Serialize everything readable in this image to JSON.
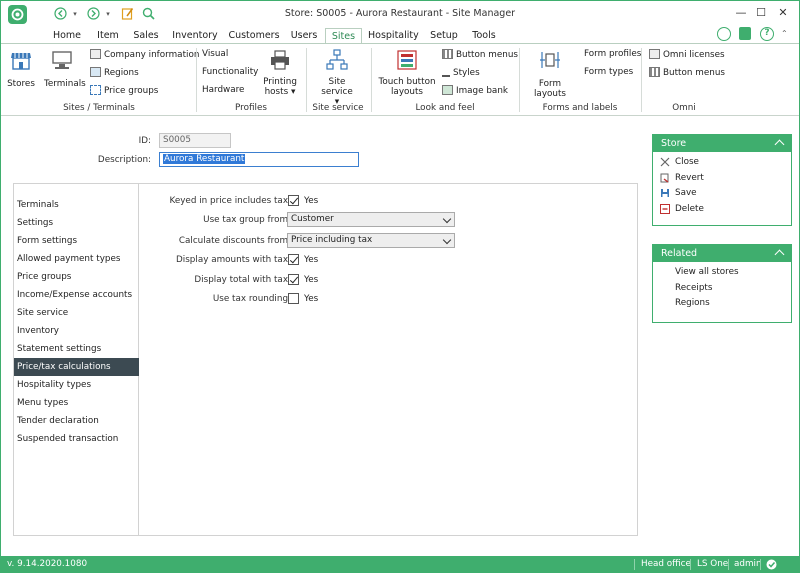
{
  "window": {
    "title": "Store: S0005 - Aurora Restaurant - Site Manager"
  },
  "tabs": [
    "Home",
    "Item",
    "Sales",
    "Inventory",
    "Customers",
    "Users",
    "Sites",
    "Hospitality",
    "Setup",
    "Tools"
  ],
  "active_tab": "Sites",
  "ribbon": {
    "sites_terminals": {
      "label": "Sites / Terminals",
      "stores": "Stores",
      "terminals": "Terminals",
      "company_information": "Company information",
      "regions": "Regions",
      "price_groups": "Price groups"
    },
    "profiles": {
      "label": "Profiles",
      "visual": "Visual",
      "functionality": "Functionality",
      "hardware": "Hardware",
      "printing_hosts_1": "Printing",
      "printing_hosts_2": "hosts"
    },
    "site_service": {
      "label": "Site service",
      "button": "Site service"
    },
    "look_and_feel": {
      "label": "Look and feel",
      "touch_button_layouts_1": "Touch button",
      "touch_button_layouts_2": "layouts",
      "button_menus": "Button menus",
      "styles": "Styles",
      "image_bank": "Image bank"
    },
    "forms_and_labels": {
      "label": "Forms and labels",
      "form_layouts": "Form layouts",
      "form_profiles": "Form profiles",
      "form_types": "Form types"
    },
    "omni": {
      "label": "Omni",
      "omni_licenses": "Omni licenses",
      "button_menus": "Button menus"
    }
  },
  "form": {
    "id_label": "ID:",
    "id_value": "S0005",
    "description_label": "Description:",
    "description_value": "Aurora Restaurant"
  },
  "nav_items": [
    "Terminals",
    "Settings",
    "Form settings",
    "Allowed payment types",
    "Price groups",
    "Income/Expense accounts",
    "Site service",
    "Inventory",
    "Statement settings",
    "Price/tax calculations",
    "Hospitality types",
    "Menu types",
    "Tender declaration",
    "Suspended transaction"
  ],
  "nav_active": "Price/tax calculations",
  "price_tax": {
    "keyed_in_label": "Keyed in price includes tax:",
    "keyed_in_checked": true,
    "use_tax_group_label": "Use tax group from:",
    "use_tax_group_value": "Customer",
    "calc_discounts_label": "Calculate discounts from:",
    "calc_discounts_value": "Price including tax",
    "display_amounts_label": "Display amounts with tax:",
    "display_amounts_checked": true,
    "display_total_label": "Display total with tax:",
    "display_total_checked": true,
    "use_tax_rounding_label": "Use tax rounding:",
    "use_tax_rounding_checked": false,
    "yes": "Yes"
  },
  "store_pane": {
    "title": "Store",
    "items": [
      "Close",
      "Revert",
      "Save",
      "Delete"
    ]
  },
  "related_pane": {
    "title": "Related",
    "items": [
      "View all stores",
      "Receipts",
      "Regions"
    ]
  },
  "status_bar": {
    "version": "v. 9.14.2020.1080",
    "site": "Head office",
    "product": "LS One",
    "user": "admin"
  },
  "colors": {
    "accent": "#3fae6e",
    "nav_active": "#3c4a52",
    "selection": "#3079d8"
  }
}
